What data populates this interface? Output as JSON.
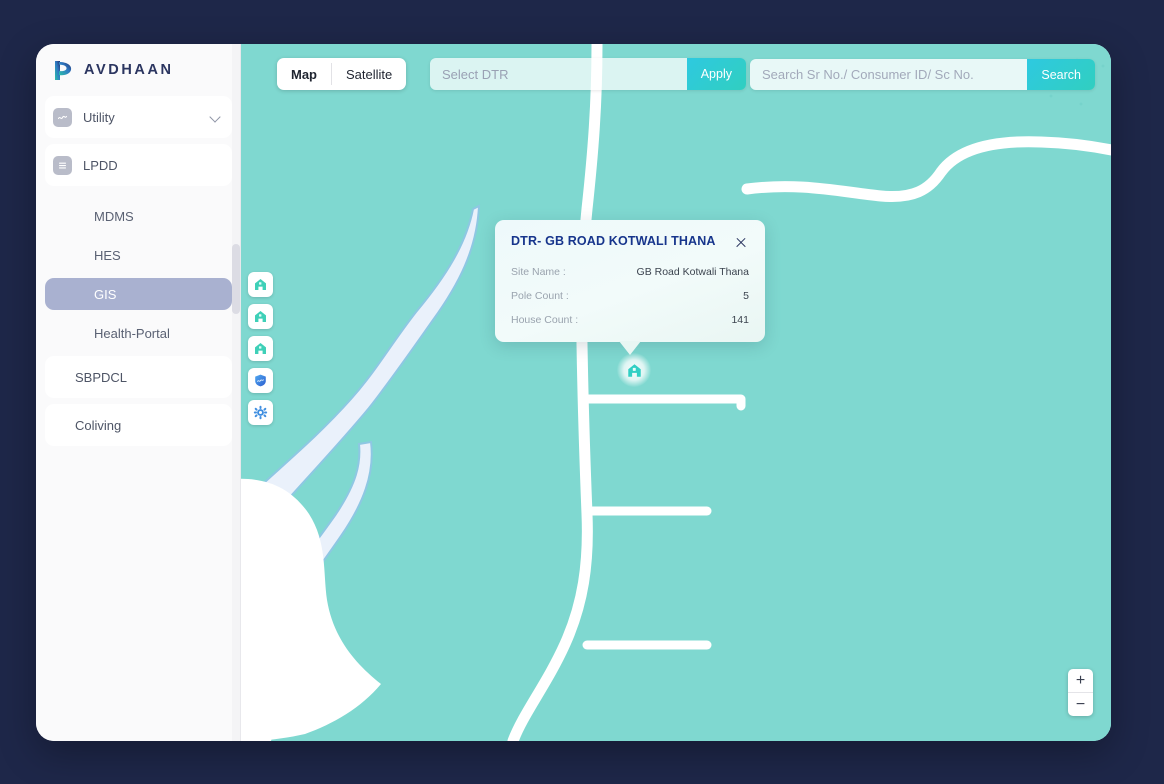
{
  "brand": {
    "name": "AVDHAAN",
    "logo_icon": "avdhaan-logo-icon"
  },
  "sidebar": {
    "groups": [
      {
        "label": "Utility",
        "icon": "chart-wave-icon",
        "expandable": true,
        "chevron_icon": "chevron-down-icon"
      },
      {
        "label": "LPDD",
        "icon": "list-lines-icon",
        "expandable": false
      }
    ],
    "sub_items": [
      {
        "label": "MDMS",
        "active": false
      },
      {
        "label": "HES",
        "active": false
      },
      {
        "label": "GIS",
        "active": true
      },
      {
        "label": "Health-Portal",
        "active": false
      }
    ],
    "plain_items": [
      {
        "label": "SBPDCL"
      },
      {
        "label": "Coliving"
      }
    ],
    "active_color": "#a9b1d0"
  },
  "toolbar": {
    "map_type": {
      "options": [
        "Map",
        "Satellite"
      ],
      "selected": "Map"
    },
    "dtr_select": {
      "placeholder": "Select DTR",
      "value": ""
    },
    "apply_label": "Apply",
    "search": {
      "placeholder": "Search Sr No./ Consumer ID/ Sc No.",
      "value": ""
    },
    "search_label": "Search",
    "button_color": "#2ec9e0"
  },
  "map_tools": [
    {
      "icon": "house-icon",
      "name": "map-tool-house-1"
    },
    {
      "icon": "house-icon",
      "name": "map-tool-house-2"
    },
    {
      "icon": "house-icon",
      "name": "map-tool-house-3"
    },
    {
      "icon": "shield-chart-icon",
      "name": "map-tool-shield"
    },
    {
      "icon": "gear-icon",
      "name": "map-tool-gear"
    }
  ],
  "zoom_controls": {
    "zoom_in": "+",
    "zoom_out": "−"
  },
  "popup": {
    "title": "DTR- GB ROAD KOTWALI THANA",
    "close_icon": "close-icon",
    "rows": [
      {
        "key": "Site Name :",
        "value": "GB Road Kotwali Thana"
      },
      {
        "key": "Pole Count :",
        "value": "5"
      },
      {
        "key": "House Count :",
        "value": "141"
      }
    ],
    "title_color": "#17358c"
  },
  "map": {
    "marker_icon": "house-marker-icon",
    "land_color": "#7fd8d0",
    "road_color": "#ffffff",
    "water_color": "#eaf1fb"
  }
}
